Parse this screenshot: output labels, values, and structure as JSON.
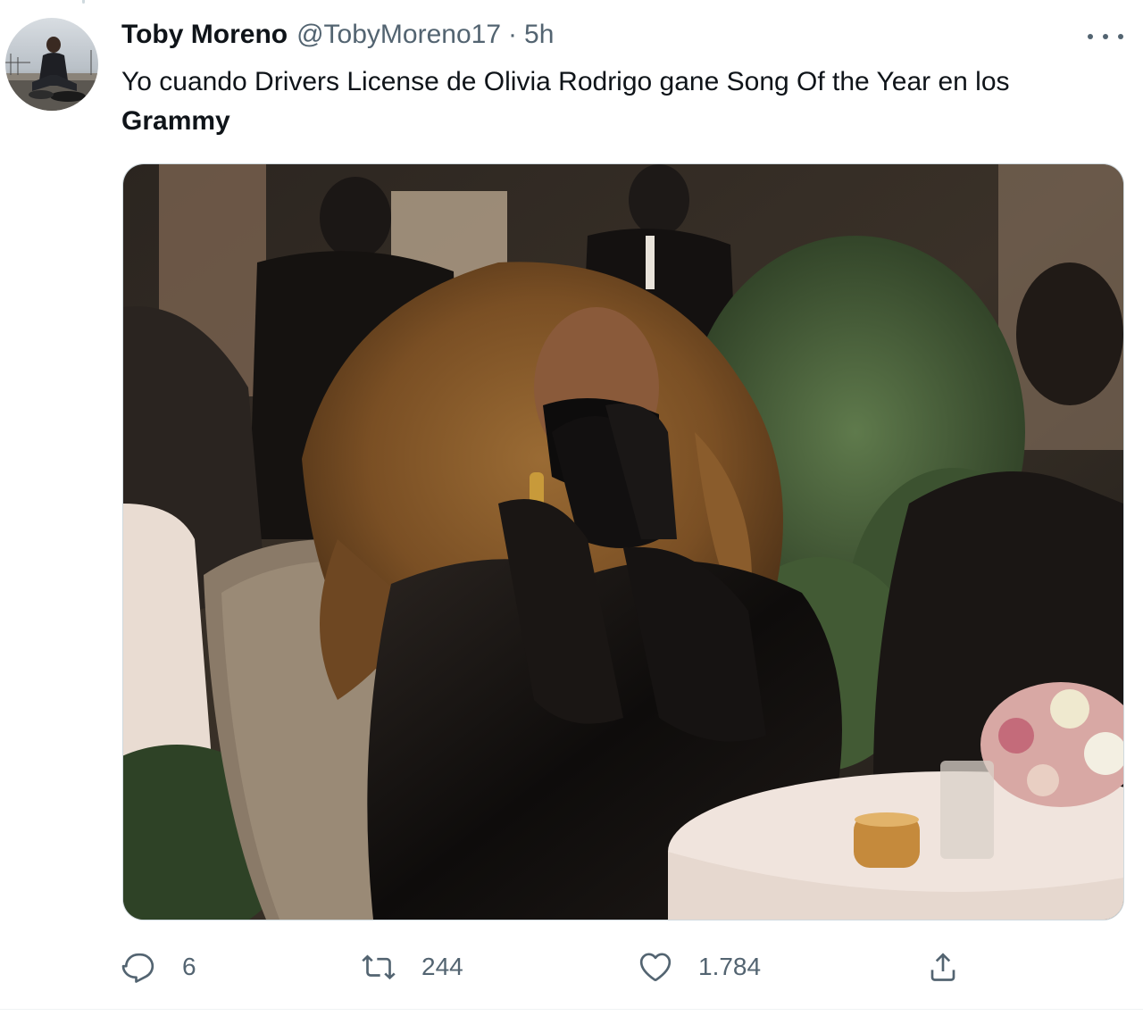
{
  "tweet": {
    "author": {
      "display_name": "Toby Moreno",
      "handle": "@TobyMoreno17",
      "separator": "·",
      "time": "5h"
    },
    "text": {
      "line": "Yo cuando Drivers License de Olivia Rodrigo gane Song Of the Year en los",
      "bold": "Grammy"
    },
    "media": {
      "alt": "photo"
    },
    "actions": {
      "replies": "6",
      "retweets": "244",
      "likes": "1.784"
    }
  },
  "colors": {
    "text_primary": "#0f1419",
    "text_secondary": "#536471",
    "border": "#cfd9de"
  }
}
